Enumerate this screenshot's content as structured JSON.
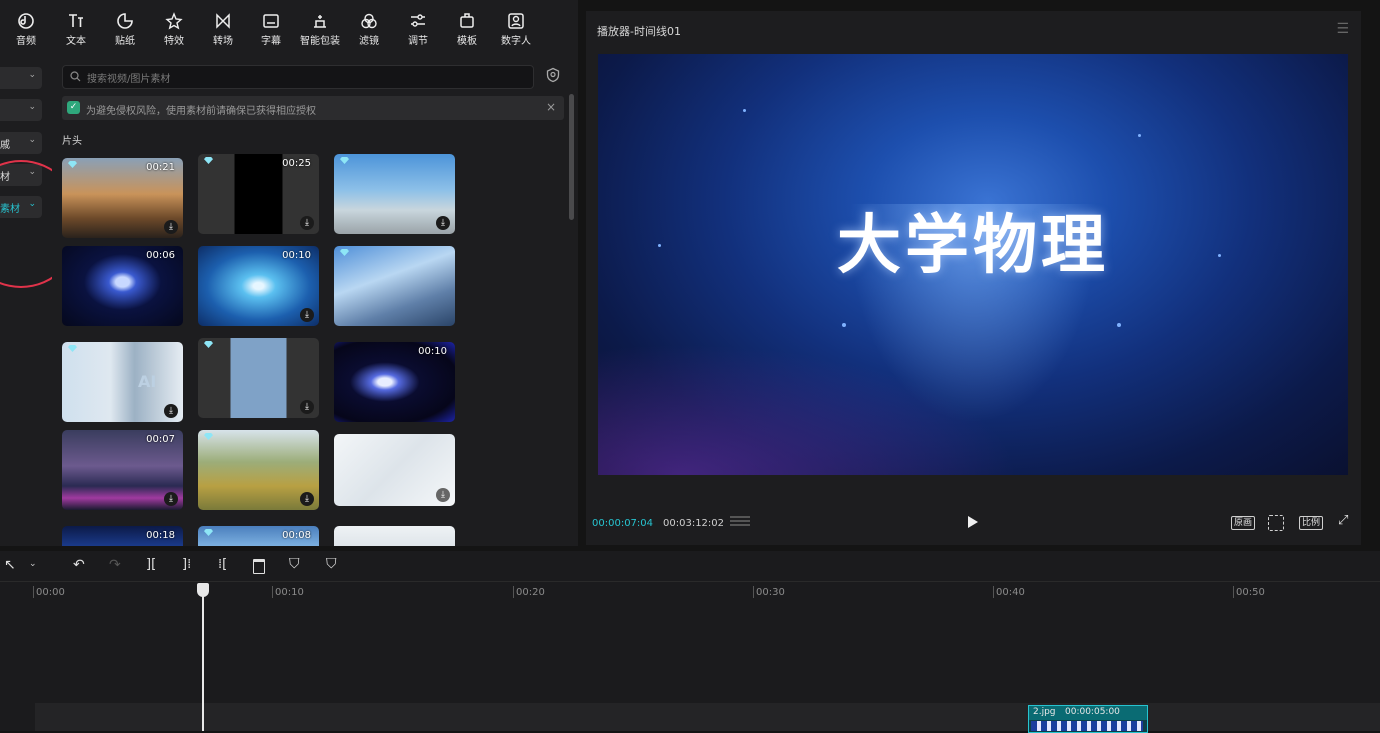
{
  "toolbar": {
    "items": [
      {
        "label": "音频",
        "icon": "audio-icon"
      },
      {
        "label": "文本",
        "icon": "text-icon"
      },
      {
        "label": "贴纸",
        "icon": "sticker-icon"
      },
      {
        "label": "特效",
        "icon": "effects-icon"
      },
      {
        "label": "转场",
        "icon": "transition-icon"
      },
      {
        "label": "字幕",
        "icon": "subtitle-icon"
      },
      {
        "label": "智能包装",
        "icon": "smart-pack-icon"
      },
      {
        "label": "滤镜",
        "icon": "filter-icon"
      },
      {
        "label": "调节",
        "icon": "adjust-icon"
      },
      {
        "label": "模板",
        "icon": "template-icon"
      },
      {
        "label": "数字人",
        "icon": "avatar-icon"
      }
    ]
  },
  "categories": [
    {
      "label": "",
      "active": false
    },
    {
      "label": "",
      "active": false
    },
    {
      "label": "戚",
      "active": false
    },
    {
      "label": "材",
      "active": false
    },
    {
      "label": "素材",
      "active": true
    }
  ],
  "media": {
    "search_placeholder": "搜索视频/图片素材",
    "notice": "为避免侵权风险，使用素材前请确保已获得相应授权",
    "section_title": "片头",
    "cards": [
      {
        "duration": "00:21",
        "premium": true
      },
      {
        "duration": "00:25",
        "premium": true
      },
      {
        "duration": "",
        "premium": true
      },
      {
        "duration": "00:06",
        "premium": false
      },
      {
        "duration": "00:10",
        "premium": false
      },
      {
        "duration": "",
        "premium": true
      },
      {
        "duration": "",
        "premium": true
      },
      {
        "duration": "",
        "premium": true
      },
      {
        "duration": "00:10",
        "premium": false
      },
      {
        "duration": "00:07",
        "premium": false
      },
      {
        "duration": "",
        "premium": true
      },
      {
        "duration": "",
        "premium": false
      },
      {
        "duration": "00:18",
        "premium": false
      },
      {
        "duration": "00:08",
        "premium": true
      },
      {
        "duration": "",
        "premium": false
      }
    ]
  },
  "player": {
    "title": "播放器-时间线01",
    "screen_text": "大学物理",
    "time_current": "00:00:07:04",
    "time_total": "00:03:12:02",
    "btn_original": "原画",
    "btn_ratio": "比例"
  },
  "timeline": {
    "ticks": [
      "00:00",
      "00:10",
      "00:20",
      "00:30",
      "00:40",
      "00:50"
    ],
    "clip_name": "2.jpg",
    "clip_duration": "00:00:05:00"
  },
  "colors": {
    "accent": "#27c4d0",
    "annotation": "#e0334a",
    "panel": "#1d1d1f"
  }
}
